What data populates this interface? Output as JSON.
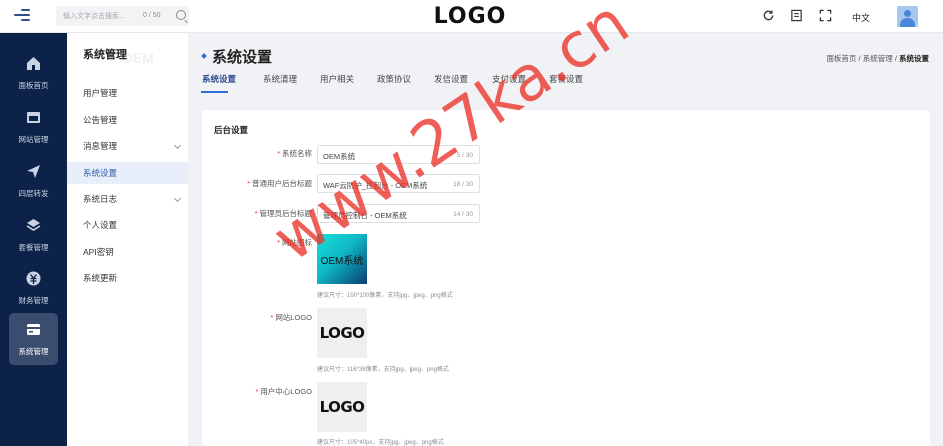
{
  "header": {
    "search_placeholder": "输入文字点击搜索...",
    "search_count": "0 / 50",
    "logo_text": "LOGO",
    "language": "中文"
  },
  "leftnav": {
    "items": [
      {
        "label": "面板首页",
        "icon": "dashboard-icon"
      },
      {
        "label": "网站管理",
        "icon": "website-icon"
      },
      {
        "label": "四层转发",
        "icon": "forward-icon"
      },
      {
        "label": "套餐管理",
        "icon": "layers-icon"
      },
      {
        "label": "财务管理",
        "icon": "finance-icon"
      },
      {
        "label": "系统管理",
        "icon": "system-icon"
      }
    ],
    "active_index": 5
  },
  "submenu": {
    "title": "系统管理",
    "watermark": "OEM",
    "items": [
      {
        "label": "用户管理",
        "expandable": false
      },
      {
        "label": "公告管理",
        "expandable": false
      },
      {
        "label": "消息管理",
        "expandable": true
      },
      {
        "label": "系统设置",
        "expandable": false
      },
      {
        "label": "系统日志",
        "expandable": true
      },
      {
        "label": "个人设置",
        "expandable": false
      },
      {
        "label": "API密钥",
        "expandable": false
      },
      {
        "label": "系统更新",
        "expandable": false
      }
    ],
    "active_index": 3
  },
  "main": {
    "page_title": "系统设置",
    "breadcrumb": [
      "面板首页",
      "系统管理",
      "系统设置"
    ],
    "breadcrumb_sep": "/",
    "tabs": [
      "系统设置",
      "系统清理",
      "用户相关",
      "政策协议",
      "发信设置",
      "支付设置",
      "套餐设置"
    ],
    "active_tab": 0
  },
  "form": {
    "section_title": "后台设置",
    "required_mark": "*",
    "fields": [
      {
        "label": "系统名称",
        "value": "OEM系统",
        "count": "5 / 30"
      },
      {
        "label": "普通用户后台标题",
        "value": "WAF云防护_控制台 - OEM系统",
        "count": "18 / 30"
      },
      {
        "label": "管理员后台标题",
        "value": "管理员控制台 - OEM系统",
        "count": "14 / 30"
      }
    ],
    "site_icon": {
      "label": "网站图标",
      "image_text": "OEM系统",
      "hint": "建议尺寸：100*100像素，支持jpg、jpeg、png格式"
    },
    "site_logo": {
      "label": "网站LOGO",
      "image_text": "LOGO",
      "hint": "建议尺寸：116*38像素，支持jpg、jpeg、png格式"
    },
    "user_logo": {
      "label": "用户中心LOGO",
      "image_text": "LOGO",
      "hint": "建议尺寸：105*40px，支持jpg、jpeg、png格式"
    }
  },
  "watermark_text": "www.27ka.cn",
  "colors": {
    "nav_bg": "#0d2248",
    "accent": "#2f6fd6",
    "required": "#e4393c",
    "watermark": "#eb3228"
  }
}
